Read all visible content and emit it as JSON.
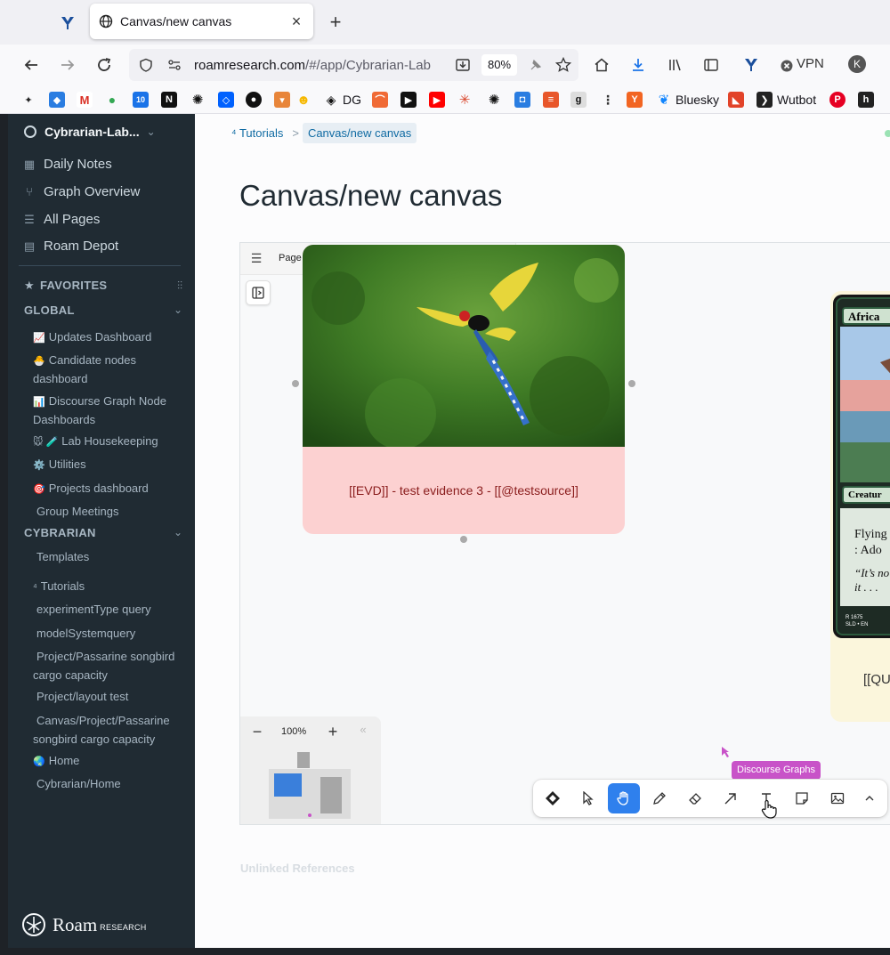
{
  "browser": {
    "tab_title": "Canvas/new canvas",
    "url_host": "roamresearch.com",
    "url_path": "/#/app/Cybrarian-Lab",
    "zoom": "80%",
    "vpn_label": "VPN",
    "profile_initial": "K",
    "bookmarks": {
      "dg_label": "DG",
      "bluesky_label": "Bluesky",
      "wutbot_label": "Wutbot",
      "calendar_badge": "10"
    }
  },
  "sidebar": {
    "graph_name": "Cybrarian-Lab...",
    "nav": [
      {
        "label": "Daily Notes",
        "icon": "calendar-icon"
      },
      {
        "label": "Graph Overview",
        "icon": "graph-icon"
      },
      {
        "label": "All Pages",
        "icon": "list-icon"
      },
      {
        "label": "Roam Depot",
        "icon": "store-icon"
      }
    ],
    "favorites_label": "FAVORITES",
    "global_label": "GLOBAL",
    "global_items": [
      {
        "emoji": "📈",
        "label": "Updates Dashboard"
      },
      {
        "emoji": "🐣",
        "label": "Candidate nodes dashboard"
      },
      {
        "emoji": "📊",
        "label": "Discourse Graph Node Dashboards"
      },
      {
        "emoji": "🐭 🧪",
        "label": "Lab Housekeeping"
      },
      {
        "emoji": "⚙️",
        "label": "Utilities"
      },
      {
        "emoji": "🎯",
        "label": "Projects dashboard"
      },
      {
        "emoji": "",
        "label": "Group Meetings"
      }
    ],
    "cybrarian_label": "CYBRARIAN",
    "cybrarian_items": [
      {
        "emoji": "",
        "label": "Templates"
      },
      {
        "emoji": "⁴",
        "label": "Tutorials"
      },
      {
        "emoji": "",
        "label": "experimentType query"
      },
      {
        "emoji": "",
        "label": "modelSystemquery"
      },
      {
        "emoji": "",
        "label": "Project/Passarine songbird cargo capacity"
      },
      {
        "emoji": "",
        "label": "Project/layout test"
      },
      {
        "emoji": "",
        "label": "Canvas/Project/Passarine songbird cargo capacity"
      },
      {
        "emoji": "🌏",
        "label": "Home"
      },
      {
        "emoji": "",
        "label": "Cybrarian/Home"
      }
    ],
    "logo_text": "Roam",
    "logo_sub": "RESEARCH"
  },
  "main": {
    "breadcrumb_parent": "⁴ Tutorials",
    "breadcrumb_sep": ">",
    "breadcrumb_current": "Canvas/new canvas",
    "title": "Canvas/new canvas",
    "unlinked_references": "Unlinked References"
  },
  "canvas": {
    "page_label": "Page 1",
    "zoom_level": "100%",
    "evidence_text": "[[EVD]] - test evidence 3 - [[@testsource]]",
    "question_text": "[[QU",
    "card_title_fragment": "Africa",
    "card_type_fragment": "Creatur",
    "card_rules_fragment_1": "Flying",
    "card_rules_fragment_2": ": Ado",
    "card_flavor_fragment": "“It’s no",
    "card_flavor_fragment_2": "it . . .",
    "card_footer": "R 1675",
    "card_footer_2": "SLD • EN",
    "tooltip": "Discourse Graphs",
    "tools": [
      "discourse-graph-icon",
      "select-icon",
      "hand-icon",
      "pencil-icon",
      "eraser-icon",
      "arrow-icon",
      "text-icon",
      "note-icon",
      "image-icon",
      "chevron-up-icon"
    ],
    "active_tool": "hand-icon"
  },
  "colors": {
    "sidebar_bg": "#202b33",
    "evidence_bg": "#fcd1d1",
    "question_bg": "#fbf6dc",
    "active_tool": "#2f80ed",
    "tooltip_bg": "#c853c8"
  }
}
